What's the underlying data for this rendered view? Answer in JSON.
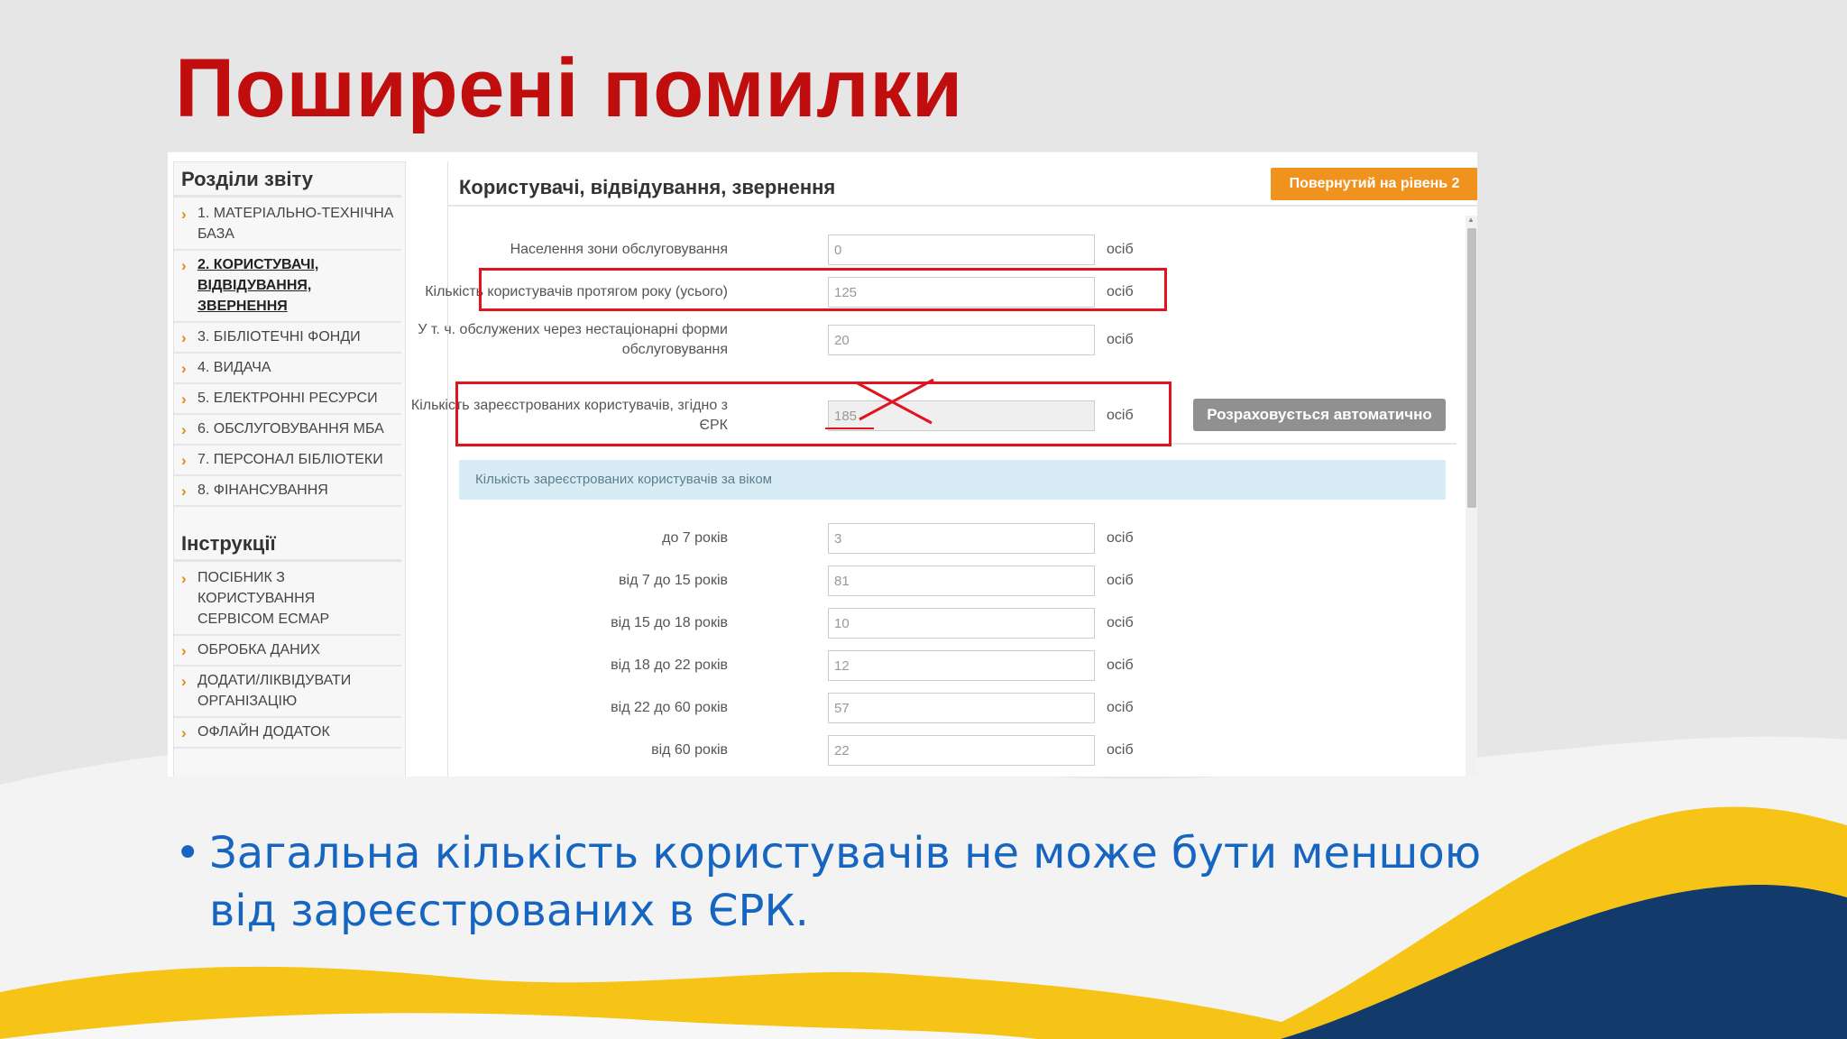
{
  "slide": {
    "title": "Поширені помилки",
    "bullet": "Загальна кількість користувачів не може бути меншою від зареєстрованих в ЄРК."
  },
  "colors": {
    "title_red": "#c00d0d",
    "bullet_blue": "#1665c1",
    "wave_yellow": "#f6c417",
    "wave_navy": "#123a6b",
    "orange_badge": "#f0921e",
    "annotation_red": "#e0141e"
  },
  "sidebar": {
    "sections_heading": "Розділи звіту",
    "sections": [
      {
        "label": "1. Матеріально-технічна база",
        "active": false
      },
      {
        "label": "2. Користувачі, відвідування, звернення",
        "active": true
      },
      {
        "label": "3. Бібліотечні фонди",
        "active": false
      },
      {
        "label": "4. Видача",
        "active": false
      },
      {
        "label": "5. Електронні ресурси",
        "active": false
      },
      {
        "label": "6. Обслуговування МБА",
        "active": false
      },
      {
        "label": "7. Персонал бібліотеки",
        "active": false
      },
      {
        "label": "8. Фінансування",
        "active": false
      }
    ],
    "instructions_heading": "Інструкції",
    "instructions": [
      {
        "label": "Посібник з користування сервісом ЕСМАР"
      },
      {
        "label": "Обробка даних"
      },
      {
        "label": "Додати/ліквідувати організацію"
      },
      {
        "label": "Офлайн додаток"
      }
    ]
  },
  "panel": {
    "title": "Користувачі, відвідування, звернення",
    "level_badge": "Повернутий на рівень 2",
    "fields": [
      {
        "label": "Населення зони обслуговування",
        "value": "0",
        "unit": "осіб"
      },
      {
        "label": "Кількість користувачів протягом року (усього)",
        "value": "125",
        "unit": "осіб"
      },
      {
        "label": "У т. ч. обслужених через нестаціонарні форми обслуговування",
        "value": "20",
        "unit": "осіб"
      },
      {
        "label": "Кількість зареєстрованих користувачів, згідно з ЄРК",
        "value": "185",
        "unit": "осіб"
      }
    ],
    "auto_button": "Розраховується автоматично",
    "age_section_label": "Кількість зареєстрованих користувачів за віком",
    "age_fields": [
      {
        "label": "до 7 років",
        "value": "3",
        "unit": "осіб"
      },
      {
        "label": "від 7 до 15 років",
        "value": "81",
        "unit": "осіб"
      },
      {
        "label": "від 15 до 18 років",
        "value": "10",
        "unit": "осіб"
      },
      {
        "label": "від 18 до 22 років",
        "value": "12",
        "unit": "осіб"
      },
      {
        "label": "від 22 до 60 років",
        "value": "57",
        "unit": "осіб"
      },
      {
        "label": "від 60 років",
        "value": "22",
        "unit": "осіб"
      }
    ]
  }
}
